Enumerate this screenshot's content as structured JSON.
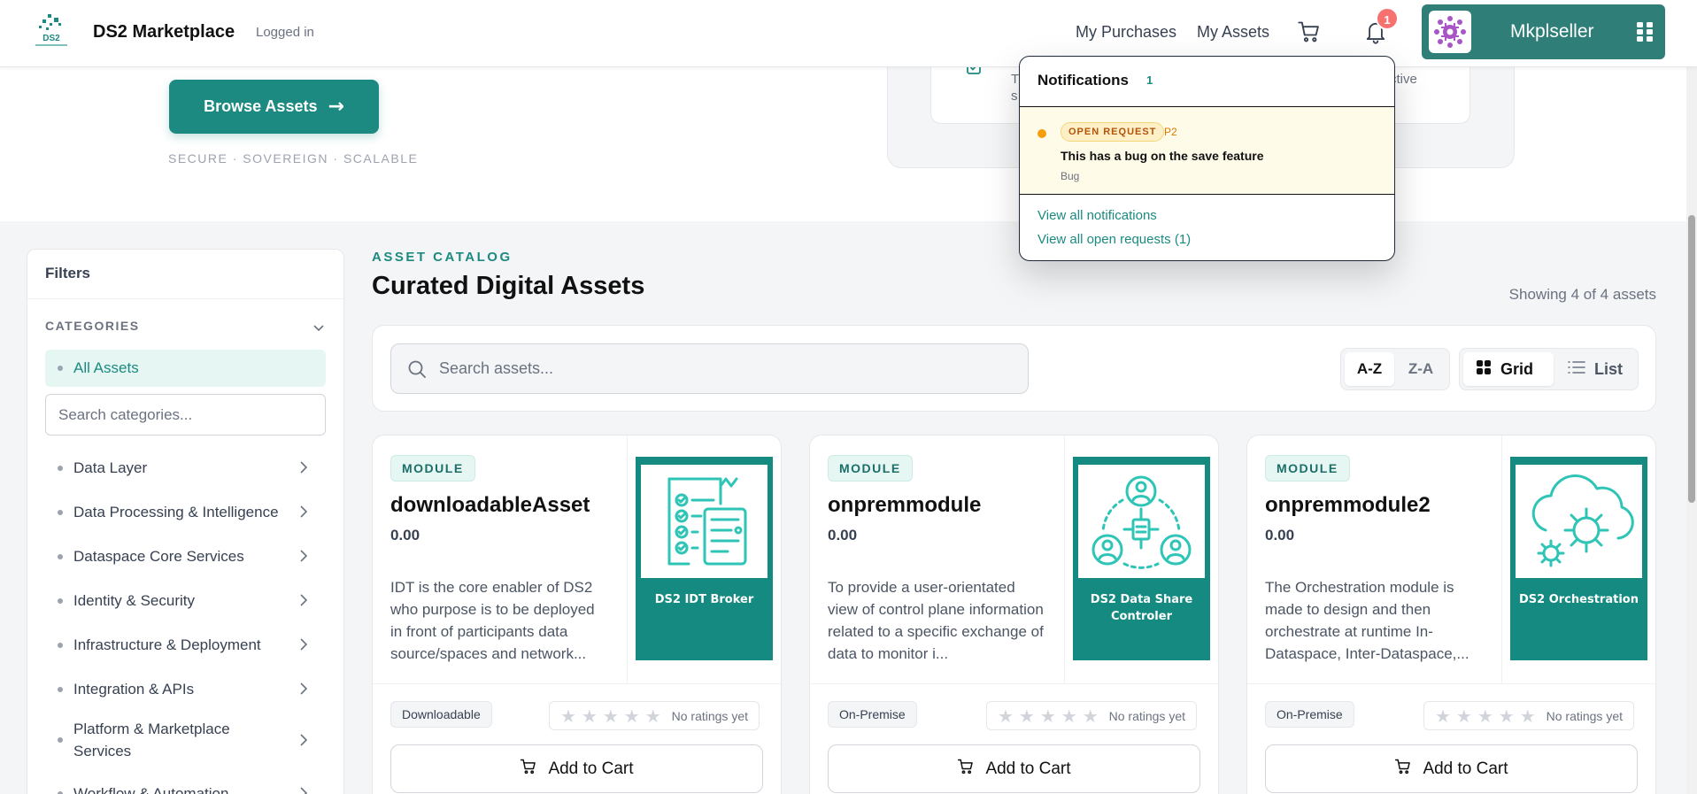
{
  "header": {
    "brand": "DS2 Marketplace",
    "logo_text": "DS2",
    "status": "Logged in",
    "nav": {
      "purchases": "My Purchases",
      "assets": "My Assets"
    },
    "notification_count": "1",
    "user": {
      "name": "Mkplseller"
    }
  },
  "hero": {
    "browse_label": "Browse Assets",
    "browse_arrow": "→",
    "tagline": "SECURE · SOVEREIGN · SCALABLE",
    "card_text_a": "T",
    "card_text_b": "s",
    "card_text_c": "ctive"
  },
  "notifications": {
    "title": "Notifications",
    "count": "1",
    "items": [
      {
        "status": "OPEN REQUEST",
        "priority": "P2",
        "title": "This has a bug on the save feature",
        "type": "Bug"
      }
    ],
    "view_all": "View all notifications",
    "view_requests": "View all open requests (1)"
  },
  "filters": {
    "title": "Filters",
    "categories_label": "CATEGORIES",
    "all_label": "All Assets",
    "search_placeholder": "Search categories...",
    "items": [
      "Data Layer",
      "Data Processing & Intelligence",
      "Dataspace Core Services",
      "Identity & Security",
      "Infrastructure & Deployment",
      "Integration & APIs",
      "Platform & Marketplace Services",
      "Workflow & Automation"
    ]
  },
  "catalog": {
    "eyebrow": "ASSET CATALOG",
    "title": "Curated Digital Assets",
    "showing": "Showing 4 of 4 assets",
    "search_placeholder": "Search assets...",
    "sort": {
      "az": "A-Z",
      "za": "Z-A",
      "active": "az"
    },
    "view": {
      "grid": "Grid",
      "list": "List",
      "active": "grid"
    }
  },
  "assets": [
    {
      "kind": "MODULE",
      "name": "downloadableAsset",
      "price": "0.00",
      "description": "IDT is the core enabler of DS2 who purpose is to be deployed in front of participants data source/spaces and network...",
      "thumb_title": "DS2 IDT Broker",
      "thumb_icon": "checklist-document-icon",
      "tag": "Downloadable",
      "rating_text": "No ratings yet",
      "rating": 0,
      "cart_label": "Add to Cart"
    },
    {
      "kind": "MODULE",
      "name": "onpremmodule",
      "price": "0.00",
      "description": "To provide a user-orientated view of control plane information related to a specific exchange of data to monitor i...",
      "thumb_title": "DS2 Data Share Controler",
      "thumb_icon": "data-share-network-icon",
      "tag": "On-Premise",
      "rating_text": "No ratings yet",
      "rating": 0,
      "cart_label": "Add to Cart"
    },
    {
      "kind": "MODULE",
      "name": "onpremmodule2",
      "price": "0.00",
      "description": "The Orchestration module is made to design and then orchestrate at runtime In-Dataspace, Inter-Dataspace,...",
      "thumb_title": "DS2 Orchestration",
      "thumb_icon": "cloud-gears-icon",
      "tag": "On-Premise",
      "rating_text": "No ratings yet",
      "rating": 0,
      "cart_label": "Add to Cart"
    }
  ],
  "colors": {
    "accent": "#1c8a80",
    "user_bg": "#2f7f78",
    "badge": "#f87171",
    "open_request": "#f59e0b"
  }
}
